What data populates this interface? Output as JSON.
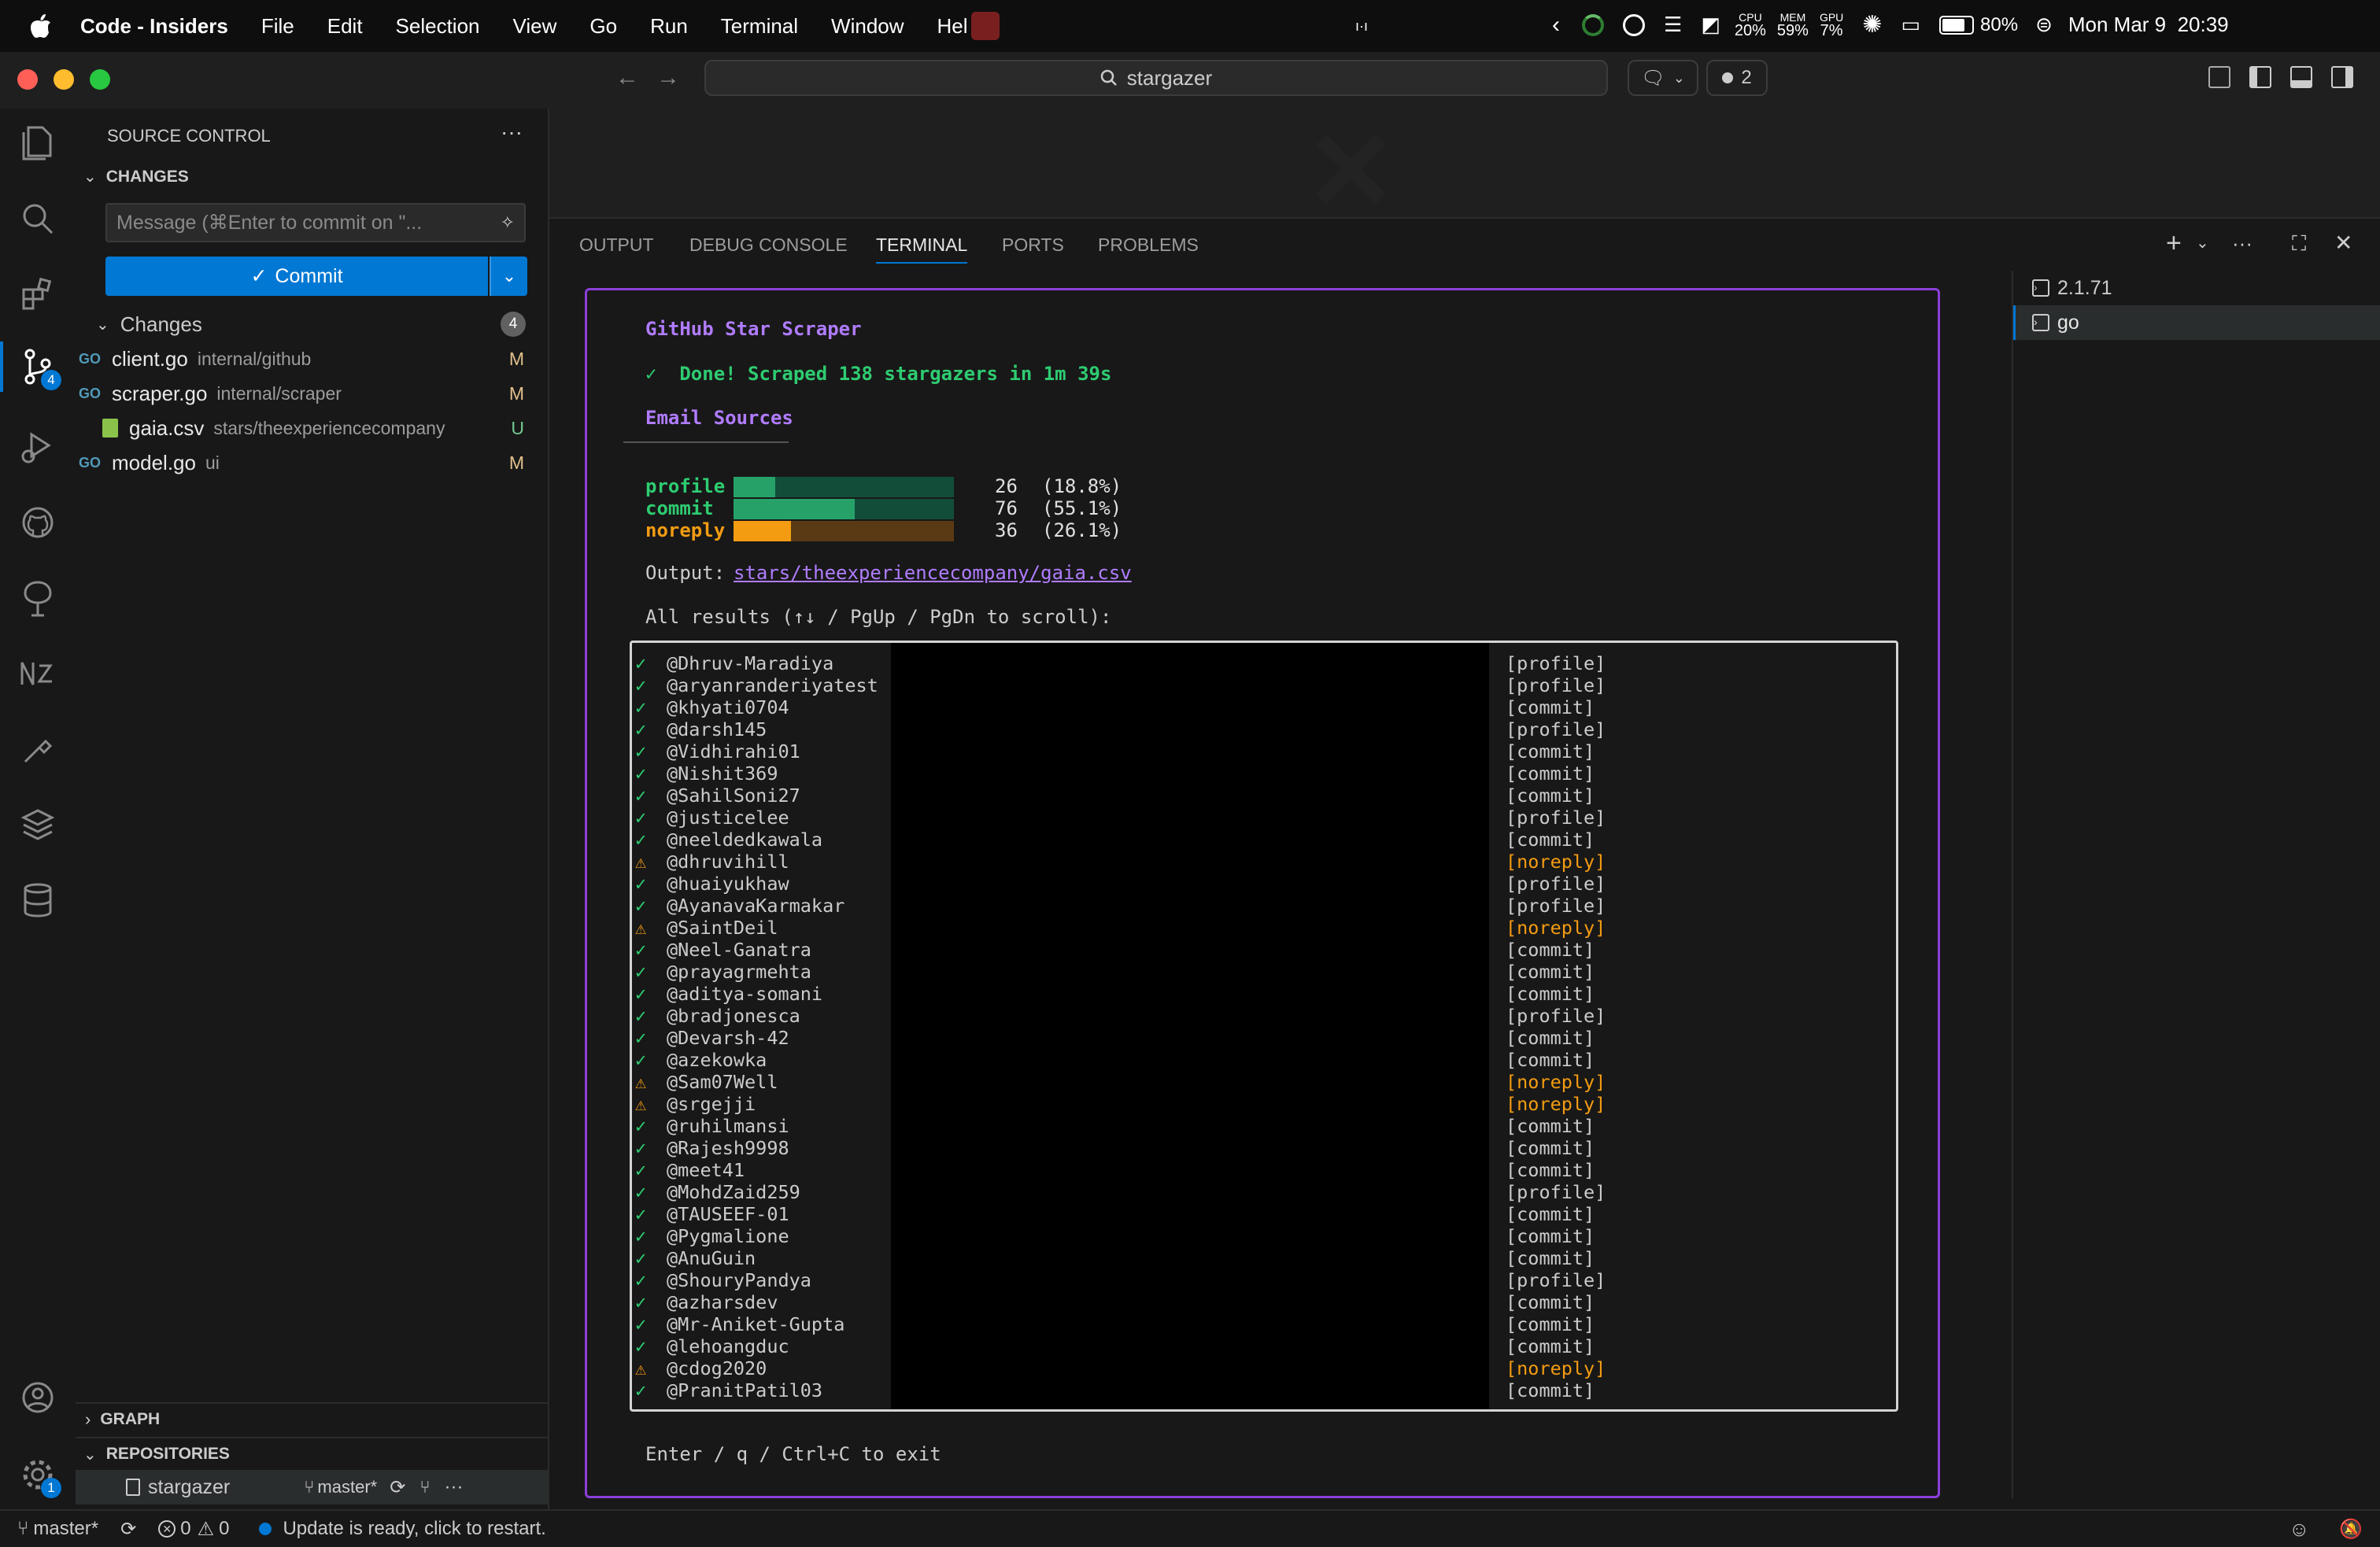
{
  "menubar": {
    "app_name": "Code - Insiders",
    "items": [
      "File",
      "Edit",
      "Selection",
      "View",
      "Go",
      "Run",
      "Terminal",
      "Window",
      "Hel"
    ],
    "cpu_label": "CPU",
    "cpu_value": "20%",
    "mem_label": "MEM",
    "mem_value": "59%",
    "gpu_label": "GPU",
    "gpu_value": "7%",
    "battery": "80%",
    "clock": "Mon Mar 9  20:39"
  },
  "titlebar": {
    "search_text": "stargazer",
    "badge_count": "2"
  },
  "activity_bar": {
    "scm_badge": "4",
    "settings_badge": "1"
  },
  "sidebar": {
    "title": "SOURCE CONTROL",
    "changes_header": "CHANGES",
    "commit_placeholder": "Message (⌘Enter to commit on \"...",
    "commit_button": "Commit",
    "changes_group": "Changes",
    "changes_count": "4",
    "files": [
      {
        "icon": "go",
        "name": "client.go",
        "path": "internal/github",
        "status": "M"
      },
      {
        "icon": "go",
        "name": "scraper.go",
        "path": "internal/scraper",
        "status": "M"
      },
      {
        "icon": "csv",
        "name": "gaia.csv",
        "path": "stars/theexperiencecompany",
        "status": "U"
      },
      {
        "icon": "go",
        "name": "model.go",
        "path": "ui",
        "status": "M"
      }
    ],
    "graph_header": "GRAPH",
    "repositories_header": "REPOSITORIES",
    "repo_name": "stargazer",
    "repo_branch": "master*"
  },
  "panel": {
    "tabs": [
      "OUTPUT",
      "DEBUG CONSOLE",
      "TERMINAL",
      "PORTS",
      "PROBLEMS"
    ],
    "active_tab": "TERMINAL",
    "terminal_sessions": [
      "2.1.71",
      "go"
    ]
  },
  "terminal": {
    "title": "GitHub Star Scraper",
    "done_msg": "✓  Done! Scraped 138 stargazers in 1m 39s",
    "section": "Email Sources",
    "bars": [
      {
        "label": "profile",
        "count": "26",
        "pct": "(18.8%)",
        "fraction": 0.188,
        "color": "#26a269",
        "track": "#124d3a"
      },
      {
        "label": "commit",
        "count": "76",
        "pct": "(55.1%)",
        "fraction": 0.551,
        "color": "#26a269",
        "track": "#124d3a"
      },
      {
        "label": "noreply",
        "count": "36",
        "pct": "(26.1%)",
        "fraction": 0.261,
        "color": "#f39c12",
        "track": "#5a3a14"
      }
    ],
    "output_label": "Output:",
    "output_path": "stars/theexperiencecompany/gaia.csv",
    "results_header": "All results (↑↓ / PgUp / PgDn to scroll):",
    "rows": [
      {
        "ok": true,
        "user": "@Dhruv-Maradiya",
        "src": "[profile]"
      },
      {
        "ok": true,
        "user": "@aryanranderiyatest",
        "src": "[profile]"
      },
      {
        "ok": true,
        "user": "@khyati0704",
        "src": "[commit]"
      },
      {
        "ok": true,
        "user": "@darsh145",
        "src": "[profile]"
      },
      {
        "ok": true,
        "user": "@Vidhirahi01",
        "src": "[commit]"
      },
      {
        "ok": true,
        "user": "@Nishit369",
        "src": "[commit]"
      },
      {
        "ok": true,
        "user": "@SahilSoni27",
        "src": "[commit]"
      },
      {
        "ok": true,
        "user": "@justicelee",
        "src": "[profile]"
      },
      {
        "ok": true,
        "user": "@neeldedkawala",
        "src": "[commit]"
      },
      {
        "ok": false,
        "user": "@dhruvihill",
        "src": "[noreply]"
      },
      {
        "ok": true,
        "user": "@huaiyukhaw",
        "src": "[profile]"
      },
      {
        "ok": true,
        "user": "@AyanavaKarmakar",
        "src": "[profile]"
      },
      {
        "ok": false,
        "user": "@SaintDeil",
        "src": "[noreply]"
      },
      {
        "ok": true,
        "user": "@Neel-Ganatra",
        "src": "[commit]"
      },
      {
        "ok": true,
        "user": "@prayagrmehta",
        "src": "[commit]"
      },
      {
        "ok": true,
        "user": "@aditya-somani",
        "src": "[commit]"
      },
      {
        "ok": true,
        "user": "@bradjonesca",
        "src": "[profile]"
      },
      {
        "ok": true,
        "user": "@Devarsh-42",
        "src": "[commit]"
      },
      {
        "ok": true,
        "user": "@azekowka",
        "src": "[commit]"
      },
      {
        "ok": false,
        "user": "@Sam07Well",
        "src": "[noreply]"
      },
      {
        "ok": false,
        "user": "@srgejji",
        "src": "[noreply]"
      },
      {
        "ok": true,
        "user": "@ruhilmansi",
        "src": "[commit]"
      },
      {
        "ok": true,
        "user": "@Rajesh9998",
        "src": "[commit]"
      },
      {
        "ok": true,
        "user": "@meet41",
        "src": "[commit]"
      },
      {
        "ok": true,
        "user": "@MohdZaid259",
        "src": "[profile]"
      },
      {
        "ok": true,
        "user": "@TAUSEEF-01",
        "src": "[commit]"
      },
      {
        "ok": true,
        "user": "@Pygmalione",
        "src": "[commit]"
      },
      {
        "ok": true,
        "user": "@AnuGuin",
        "src": "[commit]"
      },
      {
        "ok": true,
        "user": "@ShouryPandya",
        "src": "[profile]"
      },
      {
        "ok": true,
        "user": "@azharsdev",
        "src": "[commit]"
      },
      {
        "ok": true,
        "user": "@Mr-Aniket-Gupta",
        "src": "[commit]"
      },
      {
        "ok": true,
        "user": "@lehoangduc",
        "src": "[commit]"
      },
      {
        "ok": false,
        "user": "@cdog2020",
        "src": "[noreply]"
      },
      {
        "ok": true,
        "user": "@PranitPatil03",
        "src": "[commit]"
      }
    ],
    "footer": "Enter / q / Ctrl+C to exit"
  },
  "statusbar": {
    "branch": "master*",
    "errors": "0",
    "warnings": "0",
    "update_msg": "Update is ready, click to restart."
  }
}
